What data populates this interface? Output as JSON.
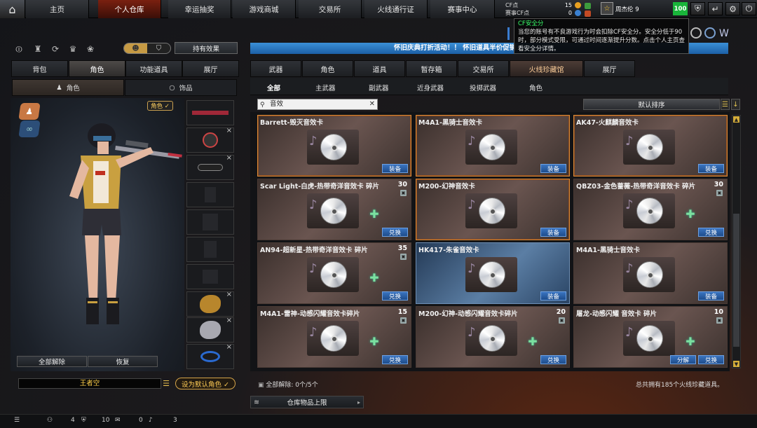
{
  "topbar": {
    "nav": [
      "主页",
      "个人仓库",
      "幸运抽奖",
      "游戏商城",
      "交易所",
      "火线通行证",
      "赛事中心"
    ],
    "active_index": 1,
    "cf_label": "CF点",
    "cf_value": "15",
    "match_cf_label": "赛事CF点",
    "match_cf_value": "0",
    "player_name": "周杰伦 9",
    "score": "100"
  },
  "tooltip": {
    "title": "CF安全分",
    "body": "当您的账号有不良游戏行为时会扣除CF安全分。安全分低于90时，部分模式受限，可通过时间逐渐提升分数。点击个人主页查看安全分详情。"
  },
  "left": {
    "effect_button": "持有效果",
    "tabs": [
      "背包",
      "角色",
      "功能道具",
      "展厅"
    ],
    "active_tab": 1,
    "subtabs": [
      "角色",
      "饰品"
    ],
    "char_tag": "角色 ✓",
    "unequip_all": "全部解除",
    "restore": "恢复",
    "name_value": "王者空",
    "set_default": "设为默认角色 ✓"
  },
  "right": {
    "marquee": "怀旧庆典打折活动！！ 怀旧道具半价促销",
    "tabs": [
      "武器",
      "角色",
      "道具",
      "暂存箱",
      "交易所",
      "火线珍藏馆",
      "展厅"
    ],
    "active_tab": 5,
    "subtabs": [
      "全部",
      "主武器",
      "副武器",
      "近身武器",
      "投掷武器",
      "角色"
    ],
    "active_subtab": 0,
    "search_value": "音效",
    "sort_label": "默认排序",
    "cards": [
      {
        "name": "Barrett-毁灭音效卡",
        "count": "",
        "buttons": [
          "装备"
        ],
        "selected": true,
        "fragment": false
      },
      {
        "name": "M4A1-黑骑士音效卡",
        "count": "",
        "buttons": [
          "装备"
        ],
        "selected": true,
        "fragment": false
      },
      {
        "name": "AK47-火麒麟音效卡",
        "count": "",
        "buttons": [
          "装备"
        ],
        "selected": true,
        "fragment": false
      },
      {
        "name": "Scar Light-白虎-热带奇洋音效卡 碎片",
        "count": "30",
        "buttons": [
          "兑换"
        ],
        "selected": false,
        "fragment": true
      },
      {
        "name": "M200-幻神音效卡",
        "count": "",
        "buttons": [
          "装备"
        ],
        "selected": true,
        "fragment": false
      },
      {
        "name": "QBZ03-金色蔷薇-热带奇洋音效卡 碎片",
        "count": "30",
        "buttons": [
          "兑换"
        ],
        "selected": false,
        "fragment": true
      },
      {
        "name": "AN94-超新星-热带奇洋音效卡 碎片",
        "count": "35",
        "buttons": [
          "兑换"
        ],
        "selected": false,
        "fragment": true
      },
      {
        "name": "HK417-朱雀音效卡",
        "count": "",
        "buttons": [
          "装备"
        ],
        "selected": false,
        "fragment": false,
        "blue": true
      },
      {
        "name": "M4A1-黑骑士音效卡",
        "count": "",
        "buttons": [
          "装备"
        ],
        "selected": false,
        "fragment": false
      },
      {
        "name": "M4A1-雷神-动感闪耀音效卡碎片",
        "count": "15",
        "buttons": [
          "兑换"
        ],
        "selected": false,
        "fragment": true
      },
      {
        "name": "M200-幻神-动感闪耀音效卡碎片",
        "count": "20",
        "buttons": [
          "兑换"
        ],
        "selected": false,
        "fragment": true
      },
      {
        "name": "屠龙-动感闪耀 音效卡 碎片",
        "count": "10",
        "buttons": [
          "分解",
          "兑换"
        ],
        "selected": false,
        "fragment": true
      }
    ],
    "footer_left": "全部解除: 0个/5个",
    "footer_right": "总共拥有185个火线珍藏道具。",
    "storage_label": "仓库物品上限"
  },
  "bottombar": {
    "a": "4",
    "b": "10",
    "c": "0",
    "d": "3"
  }
}
